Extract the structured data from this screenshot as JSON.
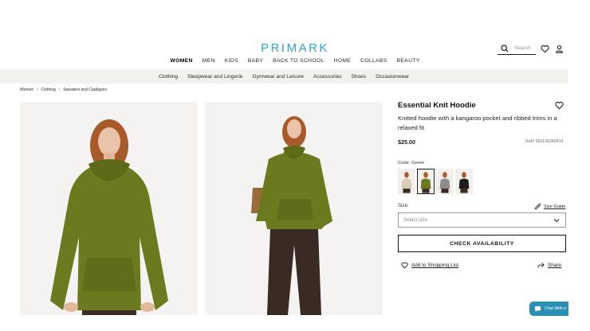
{
  "header": {
    "logo": "PRIMARK",
    "search_placeholder": "Search",
    "icons": [
      "search-icon",
      "heart-icon",
      "user-icon"
    ]
  },
  "main_nav": [
    "WOMEN",
    "MEN",
    "KIDS",
    "BABY",
    "BACK TO SCHOOL",
    "HOME",
    "COLLABS",
    "BEAUTY"
  ],
  "main_nav_active": "WOMEN",
  "sub_nav": [
    "Clothing",
    "Sleepwear and Lingerie",
    "Gymwear and Leisure",
    "Accessories",
    "Shoes",
    "Occasionwear"
  ],
  "breadcrumb": [
    "Women",
    "Clothing",
    "Sweaters and Cardigans"
  ],
  "breadcrumb_separator": "/",
  "product": {
    "title": "Essential Knit Hoodie",
    "description": "Knitted hoodie with a kangaroo pocket and ribbed trims in a relaxed fit",
    "price": "$25.00",
    "ref": "Ref# 991136280414",
    "color_label": "Color:",
    "color_value": "Green",
    "swatches": [
      {
        "name": "beige",
        "color": "#d8cbb8"
      },
      {
        "name": "green",
        "color": "#6b7a1e",
        "selected": true
      },
      {
        "name": "grey",
        "color": "#8d8d8d"
      },
      {
        "name": "black",
        "color": "#1c1c1c"
      }
    ],
    "size_label": "Size:",
    "size_guide": "Size Guide",
    "size_placeholder": "Select size",
    "check_availability": "CHECK AVAILABILITY",
    "add_to_list": "Add to Shopping List",
    "share": "Share"
  },
  "chat_label": "Chat With u",
  "colors": {
    "brand": "#2aa5d6",
    "hoodie": "#6b7a1e",
    "chat": "#2a8fb5"
  }
}
